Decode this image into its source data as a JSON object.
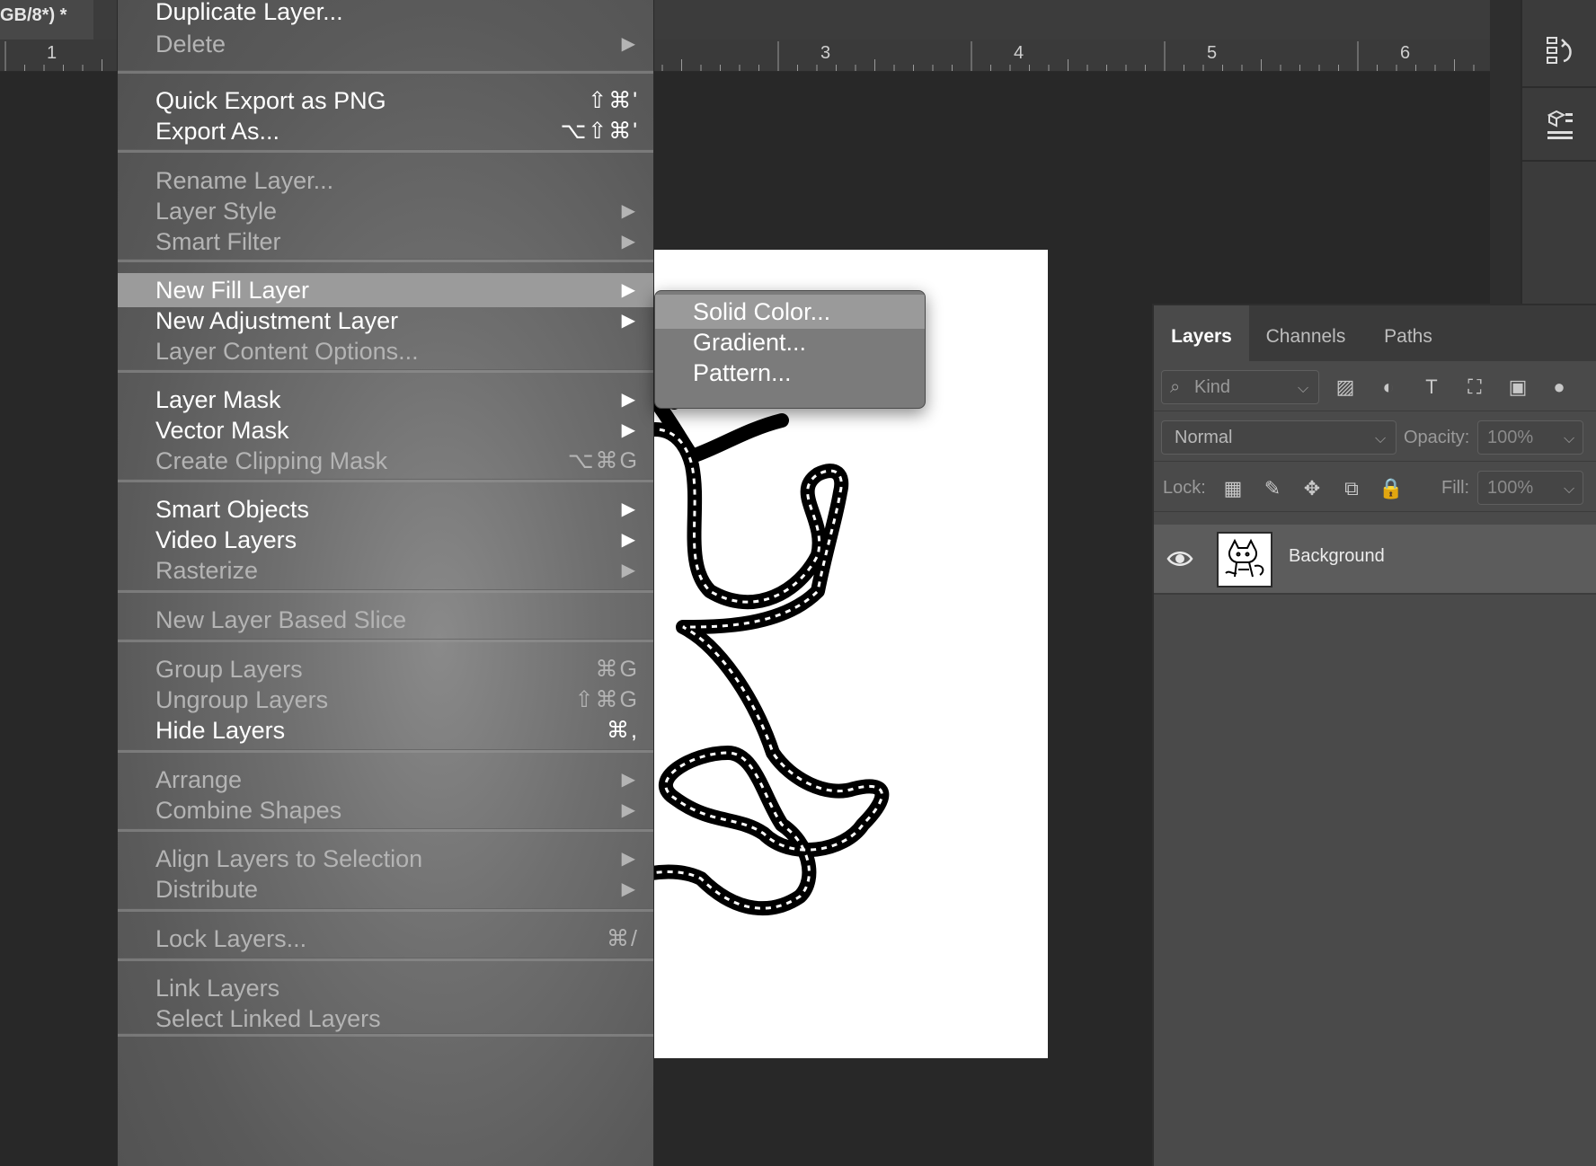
{
  "document_tab": {
    "title": "GB/8*) *"
  },
  "ruler": {
    "numbers": [
      "1",
      "3",
      "4",
      "5",
      "6"
    ]
  },
  "menu": {
    "items": [
      {
        "label": "Duplicate Layer...",
        "shortcut": "",
        "submenu": false,
        "enabled": true
      },
      {
        "label": "Delete",
        "shortcut": "",
        "submenu": true,
        "enabled": false
      },
      {
        "label": "Quick Export as PNG",
        "shortcut": "⇧⌘'",
        "submenu": false,
        "enabled": true
      },
      {
        "label": "Export As...",
        "shortcut": "⌥⇧⌘'",
        "submenu": false,
        "enabled": true
      },
      {
        "label": "Rename Layer...",
        "shortcut": "",
        "submenu": false,
        "enabled": false
      },
      {
        "label": "Layer Style",
        "shortcut": "",
        "submenu": true,
        "enabled": false
      },
      {
        "label": "Smart Filter",
        "shortcut": "",
        "submenu": true,
        "enabled": false
      },
      {
        "label": "New Fill Layer",
        "shortcut": "",
        "submenu": true,
        "enabled": true,
        "highlighted": true
      },
      {
        "label": "New Adjustment Layer",
        "shortcut": "",
        "submenu": true,
        "enabled": true
      },
      {
        "label": "Layer Content Options...",
        "shortcut": "",
        "submenu": false,
        "enabled": false
      },
      {
        "label": "Layer Mask",
        "shortcut": "",
        "submenu": true,
        "enabled": true
      },
      {
        "label": "Vector Mask",
        "shortcut": "",
        "submenu": true,
        "enabled": true
      },
      {
        "label": "Create Clipping Mask",
        "shortcut": "⌥⌘G",
        "submenu": false,
        "enabled": false
      },
      {
        "label": "Smart Objects",
        "shortcut": "",
        "submenu": true,
        "enabled": true
      },
      {
        "label": "Video Layers",
        "shortcut": "",
        "submenu": true,
        "enabled": true
      },
      {
        "label": "Rasterize",
        "shortcut": "",
        "submenu": true,
        "enabled": false
      },
      {
        "label": "New Layer Based Slice",
        "shortcut": "",
        "submenu": false,
        "enabled": false
      },
      {
        "label": "Group Layers",
        "shortcut": "⌘G",
        "submenu": false,
        "enabled": false
      },
      {
        "label": "Ungroup Layers",
        "shortcut": "⇧⌘G",
        "submenu": false,
        "enabled": false
      },
      {
        "label": "Hide Layers",
        "shortcut": "⌘,",
        "submenu": false,
        "enabled": true
      },
      {
        "label": "Arrange",
        "shortcut": "",
        "submenu": true,
        "enabled": false
      },
      {
        "label": "Combine Shapes",
        "shortcut": "",
        "submenu": true,
        "enabled": false
      },
      {
        "label": "Align Layers to Selection",
        "shortcut": "",
        "submenu": true,
        "enabled": false
      },
      {
        "label": "Distribute",
        "shortcut": "",
        "submenu": true,
        "enabled": false
      },
      {
        "label": "Lock Layers...",
        "shortcut": "⌘/",
        "submenu": false,
        "enabled": false
      },
      {
        "label": "Link Layers",
        "shortcut": "",
        "submenu": false,
        "enabled": false
      },
      {
        "label": "Select Linked Layers",
        "shortcut": "",
        "submenu": false,
        "enabled": false
      }
    ]
  },
  "submenu": {
    "items": [
      {
        "label": "Solid Color...",
        "highlighted": true
      },
      {
        "label": "Gradient...",
        "highlighted": false
      },
      {
        "label": "Pattern...",
        "highlighted": false
      }
    ]
  },
  "layers_panel": {
    "tabs": [
      "Layers",
      "Channels",
      "Paths"
    ],
    "active_tab": "Layers",
    "filter_kind": "Kind",
    "blend_mode": "Normal",
    "opacity_label": "Opacity:",
    "opacity_value": "100%",
    "lock_label": "Lock:",
    "fill_label": "Fill:",
    "fill_value": "100%",
    "layer": {
      "name": "Background",
      "visible": true
    }
  },
  "colors": {
    "menu_text_enabled": "#ffffff",
    "menu_text_disabled": "#b4b4b4",
    "highlight": "#9b9b9b",
    "app_background": "#282828"
  }
}
